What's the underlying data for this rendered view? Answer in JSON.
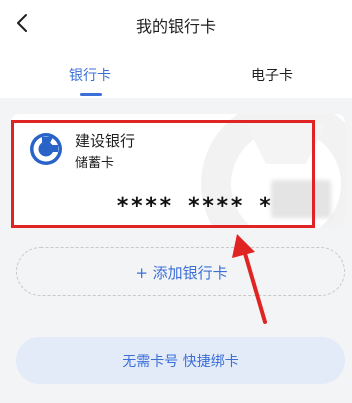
{
  "header": {
    "title": "我的银行卡",
    "back_icon": "chevron-left-icon"
  },
  "tabs": [
    {
      "label": "银行卡",
      "active": true
    },
    {
      "label": "电子卡",
      "active": false
    }
  ],
  "card": {
    "bank_name": "建设银行",
    "card_type": "储蓄卡",
    "card_number": "**** **** ****",
    "logo_icon": "ccb-logo-icon",
    "logo_color": "#2a63c8"
  },
  "add_card": {
    "label": "+ 添加银行卡"
  },
  "quick_bind": {
    "label": "无需卡号 快捷绑卡"
  },
  "colors": {
    "accent": "#3b6fd8",
    "annotation_red": "#e02424"
  }
}
